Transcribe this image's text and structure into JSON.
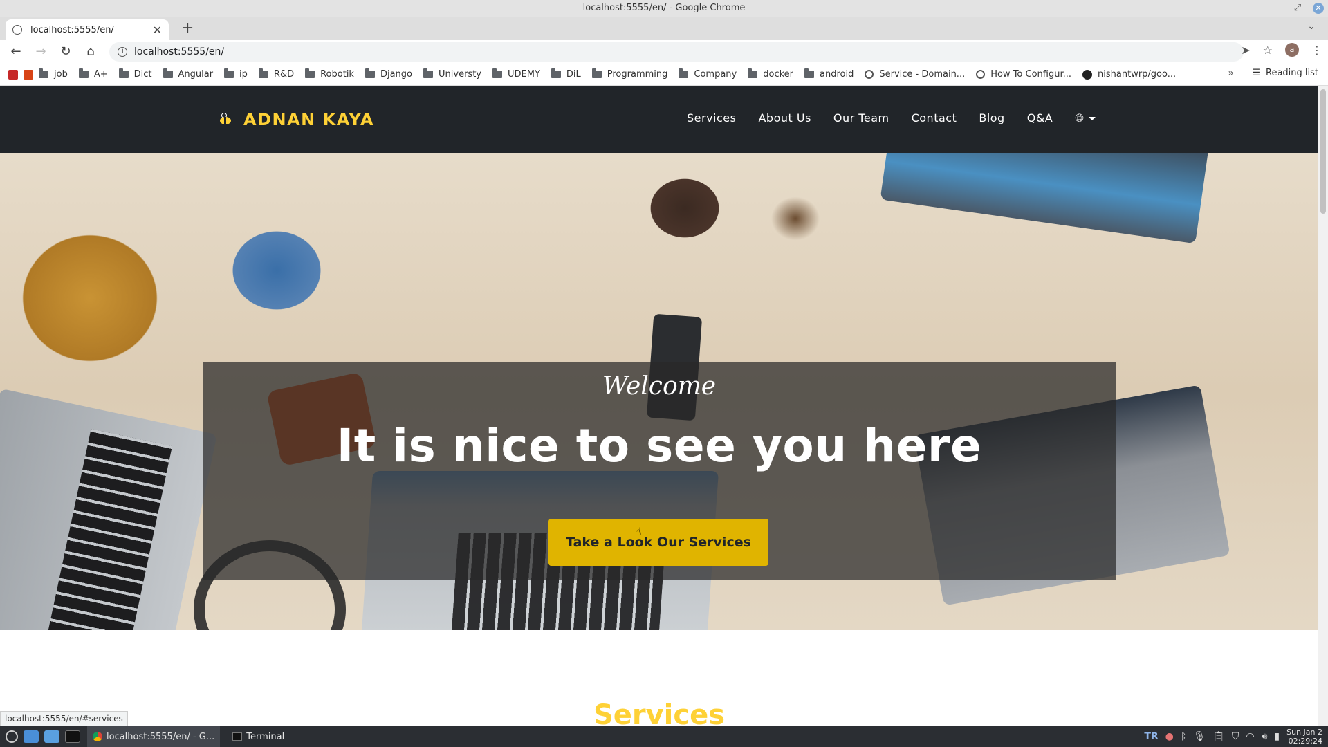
{
  "window": {
    "title": "localhost:5555/en/ - Google Chrome"
  },
  "tab": {
    "title": "localhost:5555/en/"
  },
  "toolbar": {
    "url": "localhost:5555/en/",
    "avatar_letter": "a"
  },
  "bookmarks": {
    "items": [
      "job",
      "A+",
      "Dict",
      "Angular",
      "ip",
      "R&D",
      "Robotik",
      "Django",
      "Universty",
      "UDEMY",
      "DiL",
      "Programming",
      "Company",
      "docker",
      "android"
    ],
    "service_domain": "Service - Domain...",
    "how_to": "How To Configur...",
    "github": "nishantwrp/goo...",
    "more": "»",
    "reading_list": "Reading list"
  },
  "site": {
    "brand": "ADNAN KAYA",
    "nav": [
      "Services",
      "About Us",
      "Our Team",
      "Contact",
      "Blog",
      "Q&A"
    ],
    "welcome": "Welcome",
    "headline": "It is nice to see you here",
    "cta": "Take a Look Our Services",
    "services_heading": "Services",
    "accent_color": "#fed136",
    "navbar_color": "#212529"
  },
  "status_url": "localhost:5555/en/#services",
  "taskbar": {
    "tasks": [
      "localhost:5555/en/ - G...",
      "Terminal"
    ],
    "keyboard_layout": "TR",
    "clock_date": "Sun Jan 2",
    "clock_time": "02:29:24"
  }
}
